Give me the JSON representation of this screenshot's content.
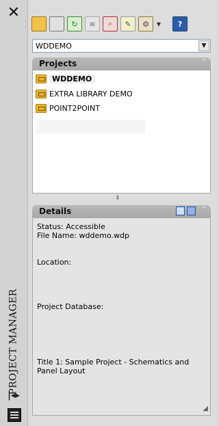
{
  "side_strip": {
    "close_glyph": "✕",
    "vertical_title": "PROJECT MANAGER"
  },
  "toolbar": {
    "icons": [
      "open-project-icon",
      "new-project-icon",
      "refresh-icon",
      "task-list-icon",
      "project-search-icon",
      "markup-manager-icon",
      "settings-icon",
      "help-icon"
    ]
  },
  "project_combo": {
    "value": "WDDEMO",
    "arrow": "▼"
  },
  "projects_panel": {
    "title": "Projects",
    "collapse_glyph": "⌃",
    "items": [
      {
        "label": "WDDEMO",
        "active": true
      },
      {
        "label": "EXTRA LIBRARY DEMO",
        "active": false
      },
      {
        "label": "POINT2POINT",
        "active": false
      }
    ]
  },
  "details_panel": {
    "title": "Details",
    "collapse_glyph": "⌃",
    "status": "Status: Accessible",
    "file_name": "File Name: wddemo.wdp",
    "location": "Location:",
    "project_database": "Project Database:",
    "title1": "Title 1: Sample Project - Schematics and Panel Layout"
  },
  "colors": {
    "panel_header": "#b0b0b0",
    "folder": "#e8b52d",
    "accent_blue": "#1a4fa0"
  }
}
